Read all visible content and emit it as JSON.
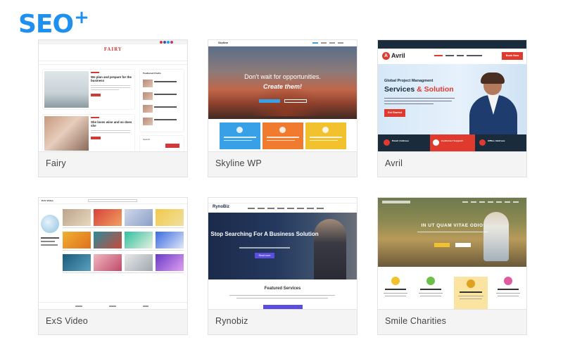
{
  "logo": {
    "text": "SEO",
    "plus": "+"
  },
  "themes": [
    {
      "name": "Fairy",
      "preview": {
        "site_title": "FAIRY",
        "post1_title": "We plan and prepare for the business",
        "post2_title": "She loves wine and so does she",
        "sidebar_heading": "Featured Posts",
        "search_label": "Search"
      }
    },
    {
      "name": "Skyline WP",
      "preview": {
        "brand": "Skyline",
        "headline_1": "Don't wait for opportunities.",
        "headline_2": "Create them!"
      }
    },
    {
      "name": "Avril",
      "preview": {
        "brand": "Avril",
        "cta_top": "Book Now",
        "eyebrow": "Global Project Managment",
        "headline_a": "Services",
        "headline_amp": "&",
        "headline_b": "Solution",
        "get_started": "Get Started",
        "contact_1": "Email Address",
        "contact_2": "Customer Support",
        "contact_3": "Office Address"
      }
    },
    {
      "name": "ExS Video",
      "preview": {
        "brand": "ExS Video"
      }
    },
    {
      "name": "Rynobiz",
      "preview": {
        "brand": "RynoBiz",
        "headline": "Stop Searching For A Business Solution",
        "cta": "Read more",
        "section": "Featured Services"
      }
    },
    {
      "name": "Smile Charities",
      "preview": {
        "headline": "IN UT QUAM VITAE ODIO"
      }
    }
  ],
  "colors": {
    "logo": "#1e90f0",
    "card_bg": "#f4f4f4",
    "fairy_accent": "#d23a3a",
    "avril_accent": "#e03a2e",
    "avril_navy": "#1a2b3c",
    "ryno_accent": "#5a4de0",
    "skyline_box_1": "#37a0e6",
    "skyline_box_2": "#f07a2e",
    "skyline_box_3": "#f2c22e"
  }
}
